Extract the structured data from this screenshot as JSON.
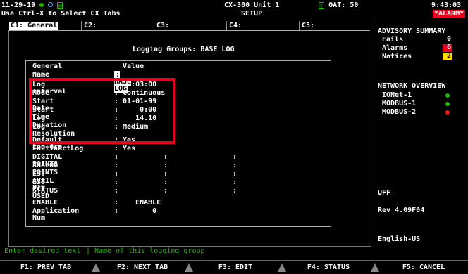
{
  "header": {
    "date": "11-29-19",
    "hint": "Use Ctrl-X to Select CX Tabs",
    "unit": "CX-300 Unit 1",
    "screen": "SETUP",
    "oat_label": "OAT:",
    "oat_value": "50",
    "time": "9:43:03",
    "alarm": "*ALARM*",
    "colors": {
      "green": "#1fb800",
      "red": "#e8001c",
      "yellow": "#ffe000"
    }
  },
  "tabs": [
    {
      "label": "C1: General",
      "active": true
    },
    {
      "label": "C2:",
      "active": false
    },
    {
      "label": "C3:",
      "active": false
    },
    {
      "label": "C4:",
      "active": false
    },
    {
      "label": "C5:",
      "active": false
    }
  ],
  "main": {
    "title": "Logging Groups: BASE LOG",
    "col_general": "General",
    "col_value": "Value",
    "rows": [
      {
        "label": "Name",
        "value": ": BASE LOG"
      },
      {
        "label": "Log Interval",
        "value": ":  0:03:00"
      },
      {
        "label": "Mode",
        "value": ": Continuous"
      },
      {
        "label": "Start Date",
        "value": ": 01-01-99"
      },
      {
        "label": "Start Time",
        "value": ":     0:00"
      },
      {
        "label": "Log Duration",
        "value": ":    14.10"
      },
      {
        "label": "Log Resolution",
        "value": ": Medium"
      },
      {
        "label": "Default Log Grp",
        "value": ": Yes"
      },
      {
        "label": "EnPtInActLog",
        "value": ": Yes"
      },
      {
        "label": "DIGITAL POINTS",
        "value": ":"
      },
      {
        "label": "ANALOG POINTS",
        "value": ":"
      },
      {
        "label": "EST AVAIL PTS",
        "value": ":"
      },
      {
        "label": "EST PCT USED",
        "value": ":"
      },
      {
        "label": "STATUS",
        "value": ":"
      },
      {
        "label": "ENABLE",
        "value": ":    ENABLE"
      },
      {
        "label": "Application Num",
        "value": ":        0"
      }
    ],
    "colon": ":"
  },
  "side": {
    "advisory_title": "ADVISORY SUMMARY",
    "fails_label": "Fails",
    "fails_value": "0",
    "alarms_label": "Alarms",
    "alarms_value": "6",
    "notices_label": "Notices",
    "notices_value": "2",
    "network_title": "NETWORK OVERVIEW",
    "networks": [
      {
        "label": "IONet-1",
        "status": "green"
      },
      {
        "label": "MODBUS-1",
        "status": "green"
      },
      {
        "label": "MODBUS-2",
        "status": "red"
      }
    ],
    "uff": "UFF",
    "rev": "Rev 4.09F04",
    "lang": "English-US"
  },
  "status_bar": {
    "left": "Enter desired text",
    "sep": "|",
    "right": "Name of this logging group"
  },
  "fkeys": [
    "F1: PREV TAB",
    "F2: NEXT TAB",
    "F3: EDIT",
    "F4: STATUS",
    "F5: CANCEL"
  ]
}
